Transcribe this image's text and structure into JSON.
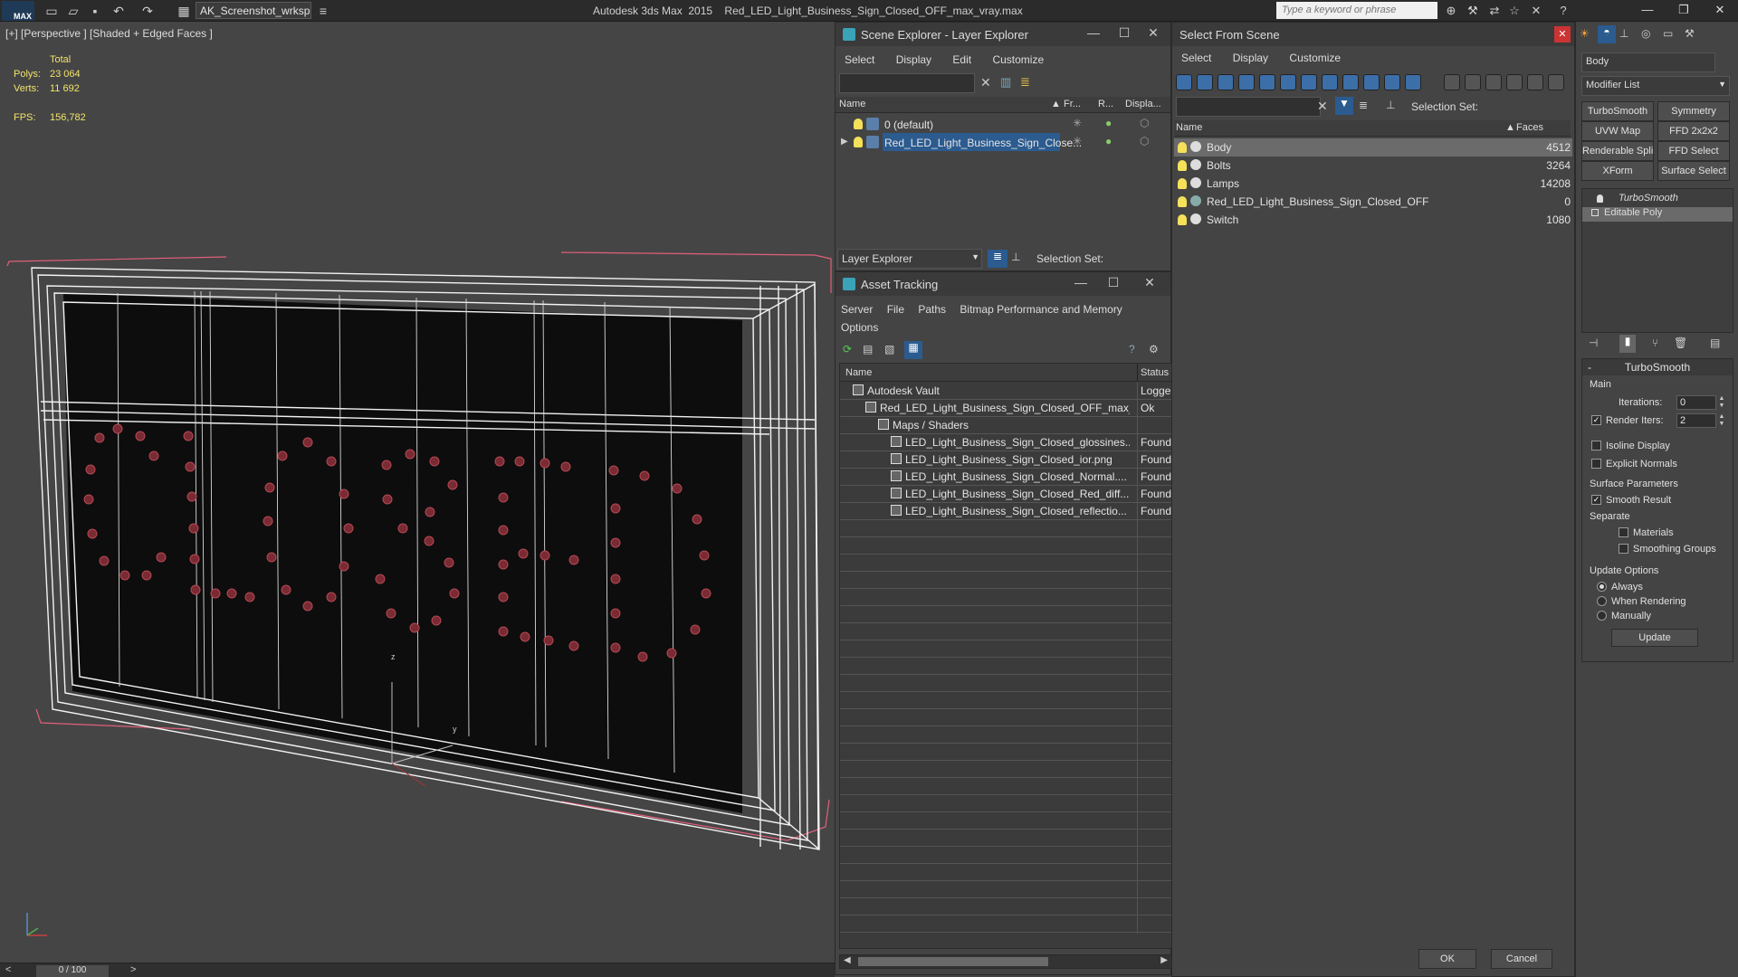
{
  "app": {
    "logo_text": "MAX",
    "workspace": "AK_Screenshot_wrksp",
    "title": "Autodesk 3ds Max  2015    Red_LED_Light_Business_Sign_Closed_OFF_max_vray.max",
    "search_placeholder": "Type a keyword or phrase"
  },
  "viewport": {
    "label": "[+] [Perspective ] [Shaded + Edged Faces ]",
    "stats": {
      "total_label": "Total",
      "polys_label": "Polys:",
      "polys_value": "23 064",
      "verts_label": "Verts:",
      "verts_value": "11 692",
      "fps_label": "FPS:",
      "fps_value": "156,782"
    },
    "axis_z": "z",
    "axis_y": "y",
    "axis_x": "x"
  },
  "timeline": {
    "frame": "0 / 100",
    "prev": "<",
    "next": ">"
  },
  "scene_explorer": {
    "title": "Scene Explorer - Layer Explorer",
    "menu": [
      "Select",
      "Display",
      "Edit",
      "Customize"
    ],
    "columns": {
      "name": "Name",
      "freeze": "Fr...",
      "render": "R...",
      "display": "Displa..."
    },
    "rows": [
      {
        "name": "0 (default)",
        "selected": false
      },
      {
        "name": "Red_LED_Light_Business_Sign_Close...",
        "selected": true
      }
    ],
    "footer_dropdown": "Layer Explorer",
    "selection_set_label": "Selection Set:"
  },
  "asset_tracking": {
    "title": "Asset Tracking",
    "menu": [
      "Server",
      "File",
      "Paths",
      "Bitmap Performance and Memory"
    ],
    "menu2": [
      "Options"
    ],
    "columns": {
      "name": "Name",
      "status": "Status"
    },
    "rows": [
      {
        "name": "Autodesk Vault",
        "status": "Logge",
        "indent": 0
      },
      {
        "name": "Red_LED_Light_Business_Sign_Closed_OFF_max_...",
        "status": "Ok",
        "indent": 1
      },
      {
        "name": "Maps / Shaders",
        "status": "",
        "indent": 2
      },
      {
        "name": "LED_Light_Business_Sign_Closed_glossines...",
        "status": "Found",
        "indent": 3
      },
      {
        "name": "LED_Light_Business_Sign_Closed_ior.png",
        "status": "Found",
        "indent": 3
      },
      {
        "name": "LED_Light_Business_Sign_Closed_Normal....",
        "status": "Found",
        "indent": 3
      },
      {
        "name": "LED_Light_Business_Sign_Closed_Red_diff...",
        "status": "Found",
        "indent": 3
      },
      {
        "name": "LED_Light_Business_Sign_Closed_reflectio...",
        "status": "Found",
        "indent": 3
      }
    ]
  },
  "select_from_scene": {
    "title": "Select From Scene",
    "menu": [
      "Select",
      "Display",
      "Customize"
    ],
    "selection_set_label": "Selection Set:",
    "columns": {
      "name": "Name",
      "faces": "Faces"
    },
    "rows": [
      {
        "name": "Body",
        "faces": "4512",
        "selected": true
      },
      {
        "name": "Bolts",
        "faces": "3264",
        "selected": false
      },
      {
        "name": "Lamps",
        "faces": "14208",
        "selected": false
      },
      {
        "name": "Red_LED_Light_Business_Sign_Closed_OFF",
        "faces": "0",
        "selected": false
      },
      {
        "name": "Switch",
        "faces": "1080",
        "selected": false
      }
    ],
    "ok": "OK",
    "cancel": "Cancel"
  },
  "command_panel": {
    "object_name": "Body",
    "modifier_list": "Modifier List",
    "buttons": [
      "TurboSmooth",
      "Symmetry",
      "UVW Map",
      "FFD 2x2x2",
      "Renderable Spline",
      "FFD Select",
      "XForm",
      "Surface Select"
    ],
    "stack": [
      "TurboSmooth",
      "Editable Poly"
    ],
    "turbosmooth": {
      "title": "TurboSmooth",
      "main": "Main",
      "iterations_label": "Iterations:",
      "iterations": "0",
      "render_iters_label": "Render Iters:",
      "render_iters": "2",
      "isoline": "Isoline Display",
      "explicit": "Explicit Normals",
      "surface_params": "Surface Parameters",
      "smooth_result": "Smooth Result",
      "separate": "Separate",
      "materials": "Materials",
      "smoothing_groups": "Smoothing Groups",
      "update_options": "Update Options",
      "always": "Always",
      "when_rendering": "When Rendering",
      "manually": "Manually",
      "update": "Update"
    }
  },
  "colors": {
    "selection_blue": "#2b5b8f",
    "stat_yellow": "#f2e36a",
    "wire_pink": "#e0607a"
  }
}
